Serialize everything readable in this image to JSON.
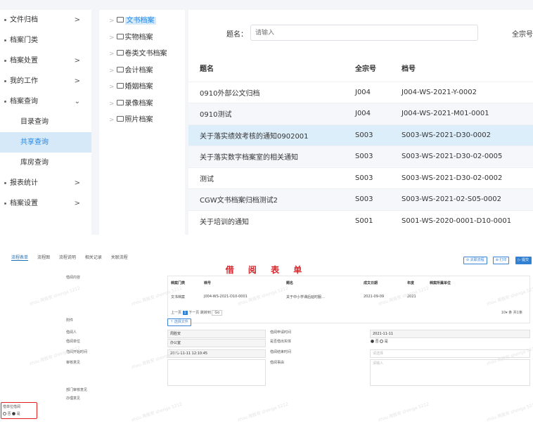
{
  "sidebar": {
    "items": [
      {
        "label": "文件归档",
        "arrow": ">"
      },
      {
        "label": "档案门类",
        "arrow": ""
      },
      {
        "label": "档案处置",
        "arrow": ">"
      },
      {
        "label": "我的工作",
        "arrow": ">"
      },
      {
        "label": "档案查询",
        "arrow": "⌄"
      }
    ],
    "sub_items": [
      {
        "label": "目录查询"
      },
      {
        "label": "共享查询"
      },
      {
        "label": "库房查询"
      }
    ],
    "items_after": [
      {
        "label": "报表统计",
        "arrow": ">"
      },
      {
        "label": "档案设置",
        "arrow": ">"
      }
    ]
  },
  "tree": {
    "items": [
      {
        "label": "文书档案"
      },
      {
        "label": "实物档案"
      },
      {
        "label": "卷类文书档案"
      },
      {
        "label": "会计档案"
      },
      {
        "label": "婚姻档案"
      },
      {
        "label": "录像档案"
      },
      {
        "label": "照片档案"
      }
    ]
  },
  "search": {
    "label": "题名：",
    "placeholder": "请输入",
    "label2": "全宗号"
  },
  "table": {
    "headers": [
      "题名",
      "全宗号",
      "档号"
    ],
    "rows": [
      {
        "title": "0910外部公文归档",
        "fonds": "J004",
        "code": "J004-WS-2021-Y-0002"
      },
      {
        "title": "0910测试",
        "fonds": "J004",
        "code": "J004-WS-2021-M01-0001"
      },
      {
        "title": "关于落实绩效考核的通知0902001",
        "fonds": "S003",
        "code": "S003-WS-2021-D30-0002"
      },
      {
        "title": "关于落实数字档案室的相关通知",
        "fonds": "S003",
        "code": "S003-WS-2021-D30-02-0005"
      },
      {
        "title": "测试",
        "fonds": "S003",
        "code": "S003-WS-2021-D30-02-0002"
      },
      {
        "title": "CGW文书档案归档测试2",
        "fonds": "S003",
        "code": "S003-WS-2021-02-S05-0002"
      },
      {
        "title": "关于培训的通知",
        "fonds": "S001",
        "code": "S001-WS-2020-0001-D10-0001"
      }
    ]
  },
  "form": {
    "tabs": [
      "流程表单",
      "流程图",
      "流程说明",
      "相关记录",
      "关联流程"
    ],
    "actions": [
      "⊘ 关联流程",
      "⊕ 打印",
      "▷ 提交"
    ],
    "title": "借 阅 表 单",
    "labels": {
      "content": "借阅内容",
      "attachment": "附件",
      "borrower": "借阅人",
      "unit": "借阅单位",
      "start_time": "借阅开始时间",
      "opinion": "审核意见",
      "apply_time": "借阅申请时间",
      "is_entity": "是否借出实体",
      "end_time": "借阅结束时间",
      "reason": "借阅事由",
      "dept_opinion": "部门审核意见",
      "handle_opinion": "办理意见",
      "unit_borrow": "借单位借阅"
    },
    "inner_headers": [
      "档案门类",
      "档号",
      "题名",
      "成文日期",
      "年度",
      "档案所属单位"
    ],
    "inner_row": [
      "文书档案",
      "J004-WS-2021-D10-0001",
      "关于中小学课后延时服…",
      "2021-09-09",
      "2021"
    ],
    "pager": {
      "prev": "上一页",
      "page": "1",
      "next": "下一页",
      "jump": "跳转到",
      "go": "Go",
      "size": "10▾",
      "total": "条 共1条"
    },
    "upload_label": "⇡ 选择文件",
    "values": {
      "borrower": "周胜安",
      "unit": "办公室",
      "start_time": "2021-11-11 12:10:45",
      "apply_time": "2021-11-11",
      "no": "否",
      "yes": "是",
      "end_placeholder": "请选择",
      "reason_placeholder": "请输入"
    },
    "watermarks": [
      "zhou 周胜安 shenga 5212"
    ]
  }
}
